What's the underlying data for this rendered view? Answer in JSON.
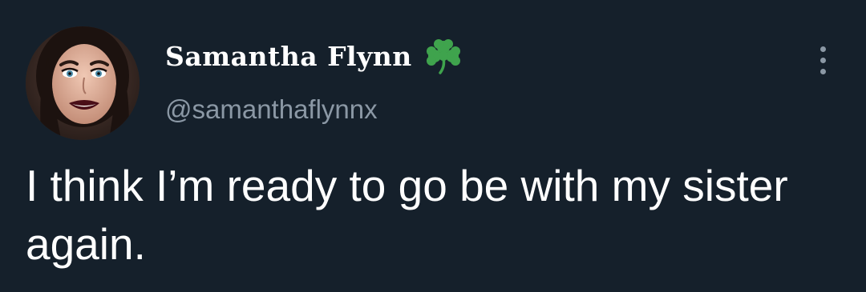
{
  "tweet": {
    "author": {
      "display_name": "Samantha Flynn",
      "handle": "@samanthaflynnx"
    },
    "text": "I think I’m ready to go be with my sister again."
  },
  "icons": {
    "badge": "shamrock-icon",
    "more": "more-vertical-icon",
    "avatar": "profile-photo"
  },
  "colors": {
    "background": "#15202b",
    "primary_text": "#ffffff",
    "secondary_text": "#8b98a5",
    "shamrock": "#3fa34d"
  }
}
